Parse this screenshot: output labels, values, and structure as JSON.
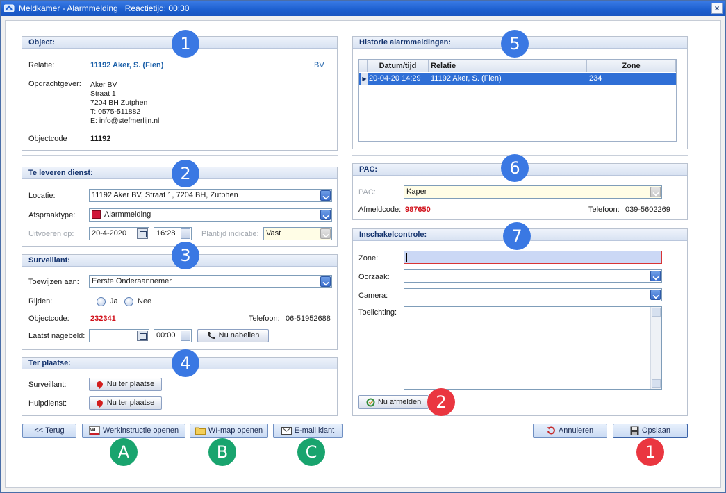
{
  "window": {
    "title": "Meldkamer - Alarmmelding",
    "response_time": "Reactietijd: 00:30",
    "close_glyph": "×"
  },
  "object": {
    "header": "Object:",
    "relatie_label": "Relatie:",
    "relatie_value": "11192 Aker, S. (Fien)",
    "relatie_tag": "BV",
    "opdrachtgever_label": "Opdrachtgever:",
    "address": [
      "Aker BV",
      "Straat 1",
      "7204 BH  Zutphen",
      "T: 0575-511882",
      "E: info@stefmerlijn.nl"
    ],
    "objectcode_label": "Objectcode",
    "objectcode_value": "11192"
  },
  "dienst": {
    "header": "Te leveren dienst:",
    "locatie_label": "Locatie:",
    "locatie_value": "11192 Aker BV, Straat 1, 7204 BH, Zutphen",
    "afspraaktype_label": "Afspraaktype:",
    "afspraaktype_value": "Alarmmelding",
    "afspraaktype_color": "#d0183a",
    "uitvoeren_label": "Uitvoeren op:",
    "date_value": "20-4-2020",
    "time_value": "16:28",
    "plantijd_label": "Plantijd indicatie:",
    "plantijd_value": "Vast"
  },
  "surveillant": {
    "header": "Surveillant:",
    "toewijzen_label": "Toewijzen aan:",
    "toewijzen_value": "Eerste Onderaannemer",
    "rijden_label": "Rijden:",
    "ja_label": "Ja",
    "nee_label": "Nee",
    "objectcode_label": "Objectcode:",
    "objectcode_value": "232341",
    "telefoon_label": "Telefoon:",
    "telefoon_value": "06-51952688",
    "laatst_label": "Laatst nagebeld:",
    "laatst_time": "00:00",
    "nabellen_button": "Nu nabellen"
  },
  "ter_plaatse": {
    "header": "Ter plaatse:",
    "surveillant_label": "Surveillant:",
    "hulpdienst_label": "Hulpdienst:",
    "button_label": "Nu ter plaatse"
  },
  "historie": {
    "header": "Historie alarmmeldingen:",
    "columns": [
      "Datum/tijd",
      "Relatie",
      "Zone"
    ],
    "rows": [
      {
        "datum": "20-04-20 14:29",
        "relatie": "11192 Aker, S.  (Fien)",
        "zone": "234"
      }
    ]
  },
  "pac": {
    "header": "PAC:",
    "pac_label": "PAC:",
    "pac_value": "Kaper",
    "afmeldcode_label": "Afmeldcode:",
    "afmeldcode_value": "987650",
    "telefoon_label": "Telefoon:",
    "telefoon_value": "039-5602269"
  },
  "inschakel": {
    "header": "Inschakelcontrole:",
    "zone_label": "Zone:",
    "oorzaak_label": "Oorzaak:",
    "camera_label": "Camera:",
    "toelichting_label": "Toelichting:",
    "afmelden_button": "Nu afmelden"
  },
  "footer": {
    "terug": "<< Terug",
    "werkinstructie": "Werkinstructie openen",
    "wi_map": "WI-map openen",
    "email": "E-mail klant",
    "annuleren": "Annuleren",
    "opslaan": "Opslaan"
  },
  "badges": {
    "b1": "1",
    "b2": "2",
    "b3": "3",
    "b4": "4",
    "b5": "5",
    "b6": "6",
    "b7": "7",
    "r2": "2",
    "r1": "1",
    "ga": "A",
    "gb": "B",
    "gc": "C"
  },
  "colors": {
    "titlebar": "#1c5fcf",
    "badge_blue": "#3a78e3",
    "badge_red": "#ea3640",
    "badge_green": "#19a46e",
    "code_red": "#d1101a",
    "link_blue": "#1b5fa8",
    "selection": "#2f6fd6"
  }
}
